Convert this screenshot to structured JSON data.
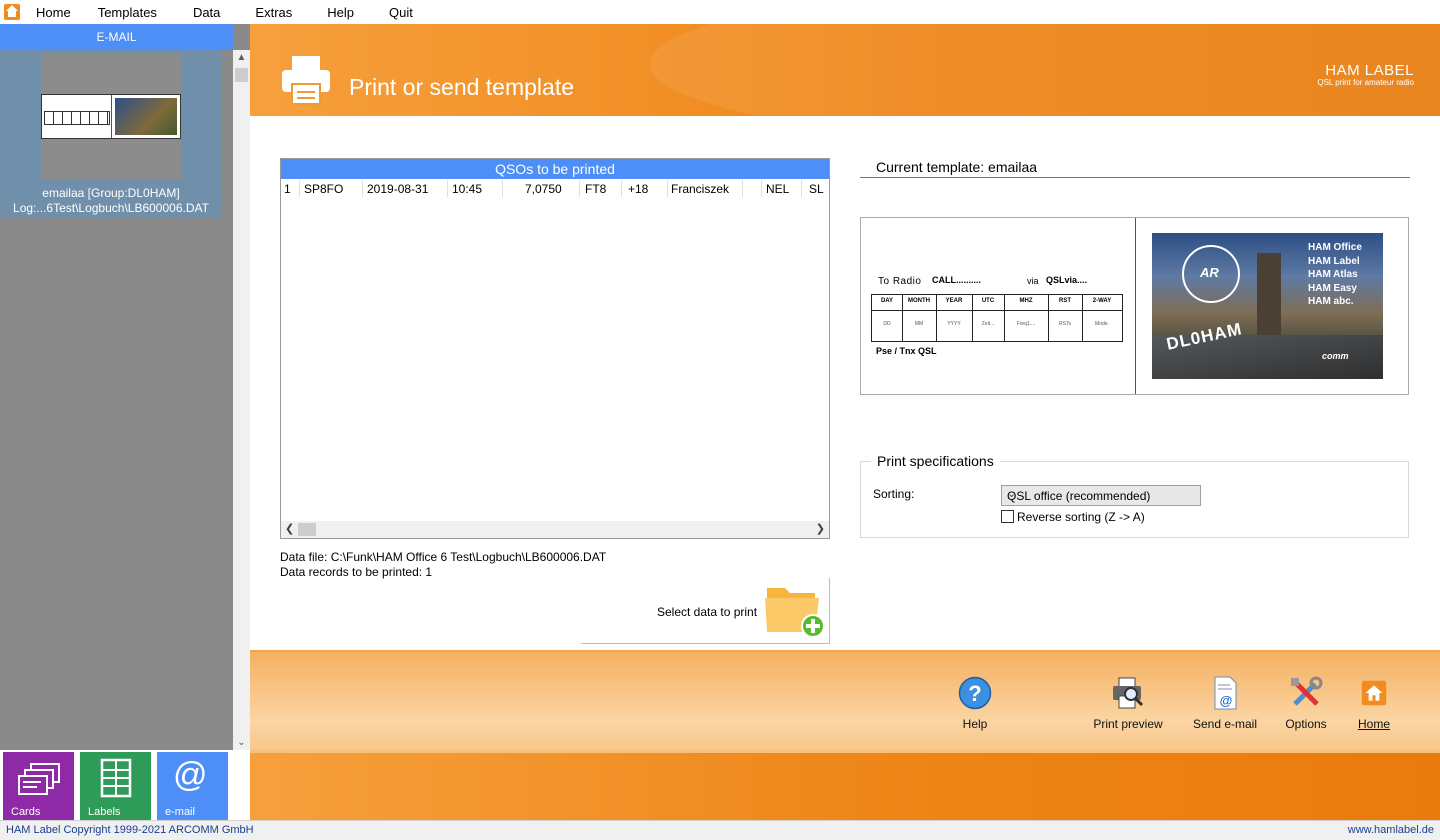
{
  "menu": {
    "items": [
      "Home",
      "Templates",
      "Data",
      "Extras",
      "Help",
      "Quit"
    ]
  },
  "sidebar": {
    "header": "E-MAIL",
    "template": {
      "name": "emailaa [Group:DL0HAM]",
      "log": "Log:...6Test\\Logbuch\\LB600006.DAT"
    },
    "tiles": [
      {
        "label": "Cards",
        "color": "#8e2aa5"
      },
      {
        "label": "Labels",
        "color": "#2f9b58"
      },
      {
        "label": "e-mail",
        "color": "#4d8ff7"
      }
    ]
  },
  "header": {
    "title": "Print or send template",
    "brand": "HAM LABEL",
    "tagline": "QSL print for amateur radio"
  },
  "qso": {
    "title": "QSOs to be printed",
    "row": {
      "nr": "1",
      "call": "SP8FO",
      "date": "2019-08-31",
      "time": "10:45",
      "freq": "7,0750",
      "mode": "FT8",
      "rst": "+18",
      "name": "Franciszek",
      "extra1": "NEL",
      "extra2": "SL"
    }
  },
  "datafile": {
    "path": "Data file: C:\\Funk\\HAM Office 6 Test\\Logbuch\\LB600006.DAT",
    "records": "Data records to be printed: 1"
  },
  "select_data": {
    "label": "Select data to print"
  },
  "template": {
    "current": "Current template: emailaa",
    "card": {
      "to_radio": "To Radio",
      "call": "CALL..........",
      "via": "via",
      "qslvia": "QSLvia....",
      "headers": [
        "DAY",
        "MONTH",
        "YEAR",
        "UTC",
        "MHZ",
        "RST",
        "2-WAY"
      ],
      "values": [
        "DD",
        "MM",
        "YYYY",
        "Zeit...",
        "Freq1....",
        "RSTs",
        "Mode."
      ],
      "footer": "Pse / Tnx  QSL",
      "photo_names": [
        "HAM Office",
        "HAM Label",
        "HAM Atlas",
        "HAM Easy",
        "HAM abc."
      ],
      "photo_call": "DL0HAM",
      "photo_logo": "comm"
    }
  },
  "specs": {
    "title": "Print specifications",
    "sorting_label": "Sorting:",
    "sorting_value": "QSL office (recommended)",
    "reverse_label": "Reverse sorting (Z -> A)",
    "reverse_checked": false
  },
  "toolbar": {
    "help": "Help",
    "print_preview": "Print preview",
    "send_email": "Send e-mail",
    "options": "Options",
    "home": "Home"
  },
  "status": {
    "copyright": "HAM Label Copyright 1999-2021 ARCOMM GmbH",
    "url": "www.hamlabel.de"
  }
}
